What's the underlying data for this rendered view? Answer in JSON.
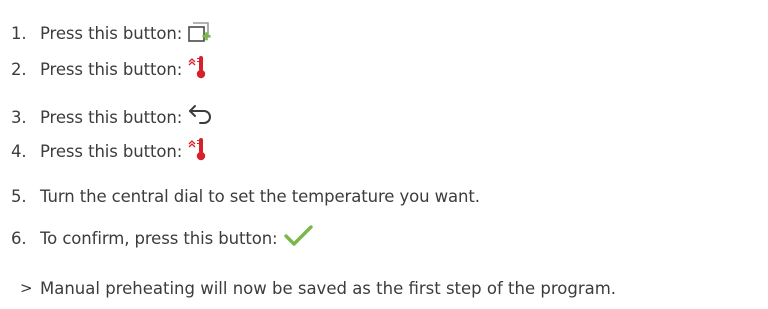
{
  "steps": [
    {
      "number": "1.",
      "text": "Press this button:",
      "icon": "add-step-icon"
    },
    {
      "number": "2.",
      "text": "Press this button:",
      "icon": "preheat-thermometer-icon"
    },
    {
      "number": "3.",
      "text": "Press this button:",
      "icon": "back-arrow-icon"
    },
    {
      "number": "4.",
      "text": "Press this button:",
      "icon": "preheat-thermometer-icon"
    },
    {
      "number": "5.",
      "text": "Turn the central dial to set the temperature you want.",
      "icon": ""
    },
    {
      "number": "6.",
      "text": "To confirm, press this button:",
      "icon": "checkmark-icon"
    }
  ],
  "result": {
    "marker": ">",
    "text": "Manual preheating will now be saved as the first step of the program."
  },
  "colors": {
    "text": "#3c3c3c",
    "accent_green": "#7ab648",
    "thermo_red": "#d6202a",
    "icon_gray": "#4a4a4a"
  }
}
